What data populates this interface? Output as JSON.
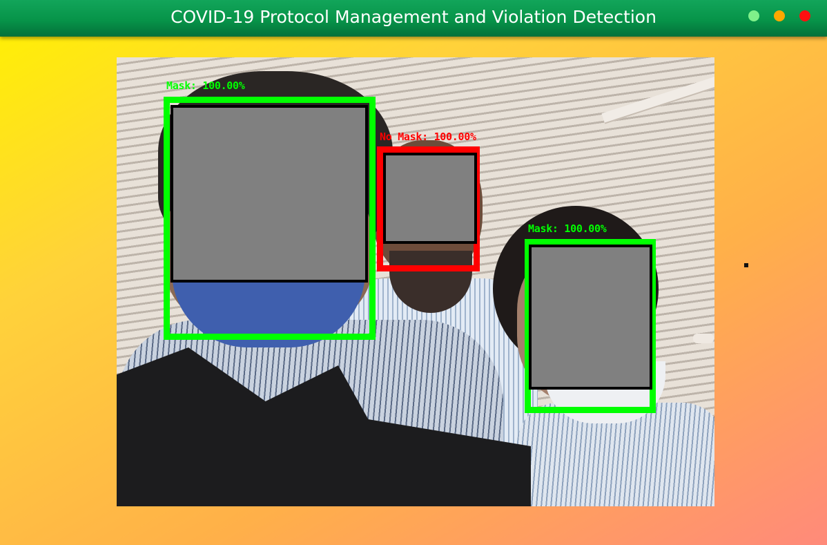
{
  "window": {
    "title": "COVID-19 Protocol Management and Violation Detection",
    "controls": [
      {
        "name": "maximize",
        "color": "#7ff08a"
      },
      {
        "name": "minimize",
        "color": "#ffa800"
      },
      {
        "name": "close",
        "color": "#ff1010"
      }
    ]
  },
  "detections": [
    {
      "label": "Mask: 100.00%",
      "status": "mask",
      "color": "#00ff00"
    },
    {
      "label": "No Mask: 100.00%",
      "status": "no-mask",
      "color": "#ff0000"
    },
    {
      "label": "Mask: 100.00%",
      "status": "mask",
      "color": "#00ff00"
    }
  ],
  "colors": {
    "titlebar": "#079449",
    "mask_box": "#00ff00",
    "no_mask_box": "#ff0000",
    "face_redaction": "#808080"
  }
}
